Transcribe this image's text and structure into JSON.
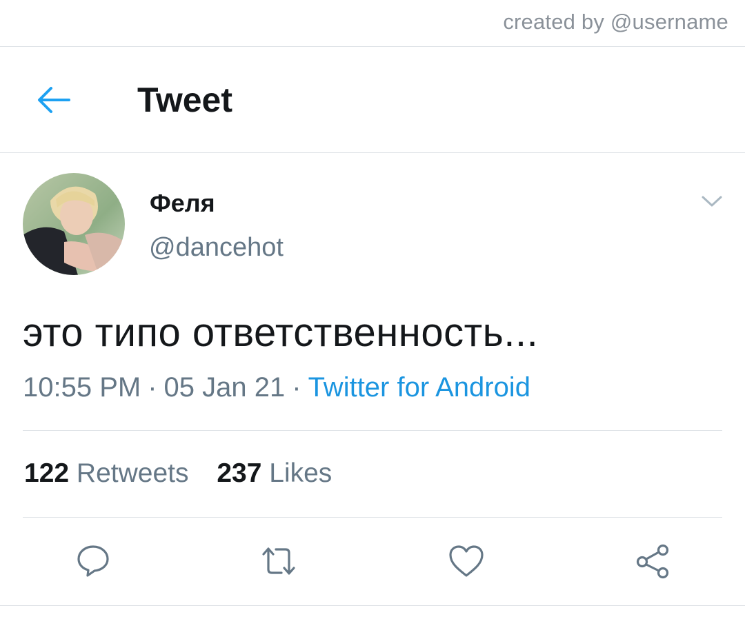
{
  "credit": "created by @username",
  "header": {
    "back_icon": "arrow-left-icon",
    "title": "Tweet",
    "accent": "#1da1f2"
  },
  "tweet": {
    "author": {
      "name": "Феля",
      "handle": "@dancehot"
    },
    "text": "это типо ответственность...",
    "time": "10:55 PM",
    "date": "05 Jan 21",
    "separator": "·",
    "source": "Twitter for Android",
    "source_color": "#1b95e0"
  },
  "stats": {
    "retweets_count": "122",
    "retweets_label": "Retweets",
    "likes_count": "237",
    "likes_label": "Likes"
  },
  "actions": [
    {
      "name": "reply",
      "icon": "speech-bubble-icon"
    },
    {
      "name": "retweet",
      "icon": "retweet-icon"
    },
    {
      "name": "like",
      "icon": "heart-icon"
    },
    {
      "name": "share",
      "icon": "share-icon"
    }
  ]
}
